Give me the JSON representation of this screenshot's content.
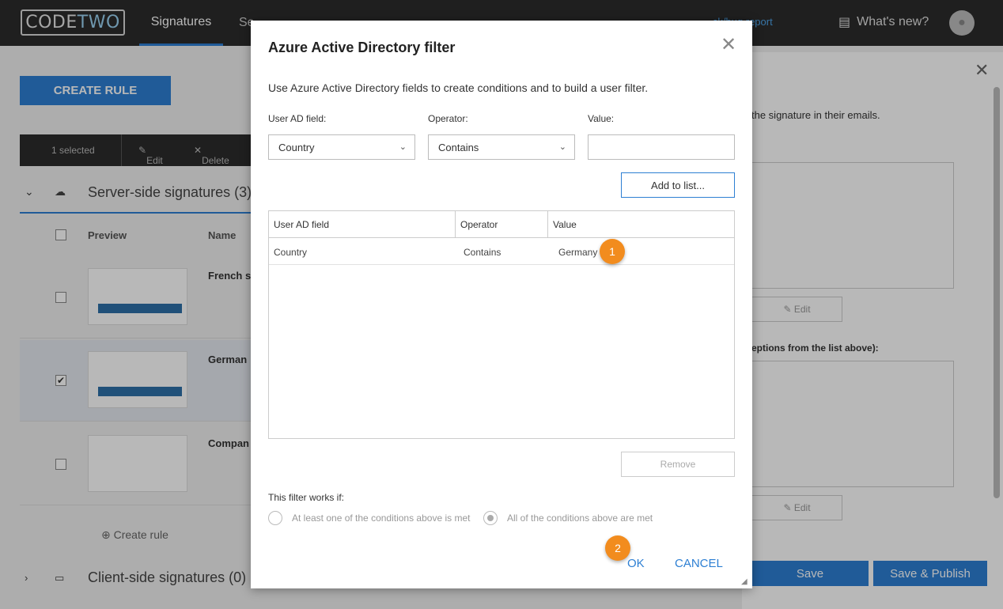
{
  "header": {
    "logo_left": "CODE",
    "logo_right": "TWO",
    "tabs": [
      "Signatures",
      "Se",
      "...",
      "..."
    ],
    "feedback": "...ck/bug report",
    "whats_new": "What's new?"
  },
  "left": {
    "create_rule_label": "CREATE RULE",
    "toolbar": {
      "selected": "1 selected",
      "edit": "Edit",
      "delete": "Delete"
    },
    "section_label": "Server-side signatures (3)",
    "columns": {
      "preview": "Preview",
      "name": "Name"
    },
    "rows": [
      {
        "name": "French s"
      },
      {
        "name": "German"
      },
      {
        "name": "Compan"
      }
    ],
    "create_rule_link": "Create rule",
    "client_section_label": "Client-side signatures (0)"
  },
  "right": {
    "text1": "the signature in their emails.",
    "edit_label": "Edit",
    "text2": "eptions from the list above):",
    "save_label": "Save",
    "save_publish_label": "Save & Publish"
  },
  "modal": {
    "title": "Azure Active Directory filter",
    "description": "Use Azure Active Directory fields to create conditions and to build a user filter.",
    "labels": {
      "field": "User AD field:",
      "operator": "Operator:",
      "value": "Value:"
    },
    "field_selected": "Country",
    "operator_selected": "Contains",
    "value_input": "",
    "add_button": "Add to list...",
    "grid": {
      "headers": [
        "User AD field",
        "Operator",
        "Value"
      ],
      "rows": [
        {
          "field": "Country",
          "operator": "Contains",
          "value": "Germany"
        }
      ]
    },
    "remove_button": "Remove",
    "works_label": "This filter works if:",
    "radio_any": "At least one of the conditions above is met",
    "radio_all": "All of the conditions above are met",
    "ok_button": "OK",
    "cancel_button": "CANCEL",
    "badges": [
      "1",
      "2"
    ]
  },
  "colors": {
    "accent": "#2d7fd3",
    "badge": "#f28c1e",
    "topbar": "#2b2b2b"
  }
}
